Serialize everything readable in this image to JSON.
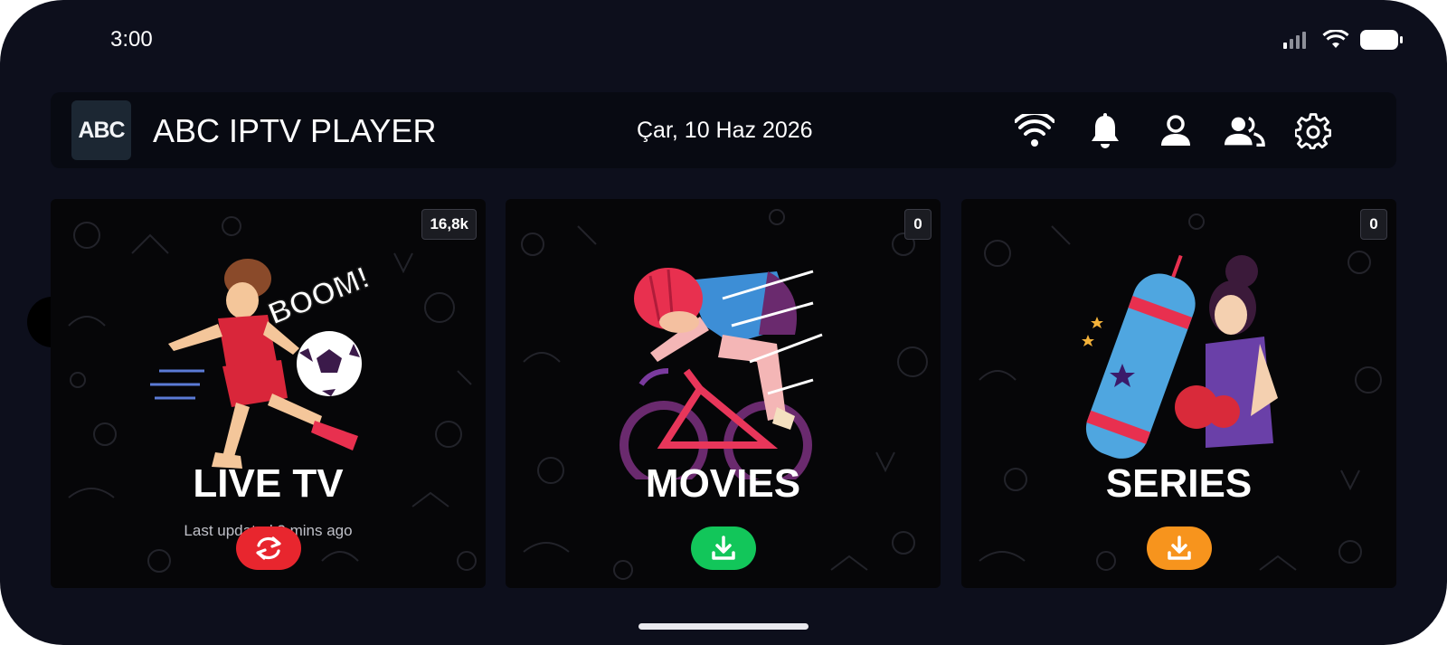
{
  "status_bar": {
    "time": "3:00"
  },
  "header": {
    "logo_text": "ABC",
    "app_title": "ABC IPTV PLAYER",
    "date": "Çar, 10 Haz 2026",
    "icons": [
      "wifi-icon",
      "bell-icon",
      "user-icon",
      "users-icon",
      "gear-icon"
    ]
  },
  "cards": [
    {
      "title": "LIVE TV",
      "badge": "16,8k",
      "subtitle": "Last updated 3 mins ago",
      "illustration_text": "BOOM!",
      "button_icon": "refresh-icon",
      "button_color": "#e8262e"
    },
    {
      "title": "MOVIES",
      "badge": "0",
      "button_icon": "download-icon",
      "button_color": "#12c65a"
    },
    {
      "title": "SERIES",
      "badge": "0",
      "button_icon": "download-icon",
      "button_color": "#f7941d"
    }
  ]
}
